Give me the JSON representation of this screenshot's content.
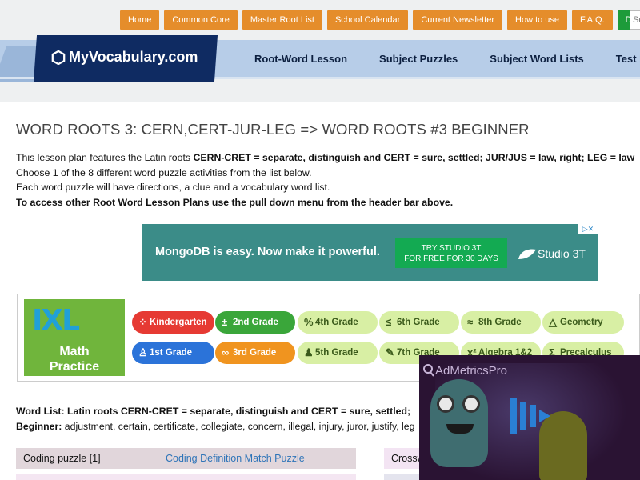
{
  "topnav": [
    "Home",
    "Common Core",
    "Master Root List",
    "School Calendar",
    "Current Newsletter",
    "How to use",
    "F.A.Q.",
    "Donate"
  ],
  "search_placeholder": "Se",
  "logo": "MyVocabulary.com",
  "mainnav": [
    "Root-Word Lesson",
    "Subject Puzzles",
    "Subject Word Lists",
    "Test Pre"
  ],
  "page_title": "WORD ROOTS 3: CERN,CERT-JUR-LEG => WORD ROOTS #3 BEGINNER",
  "intro": {
    "line1_prefix": "This lesson plan features the Latin roots ",
    "line1_bold": "CERN-CRET = separate, distinguish and CERT = sure, settled; JUR/JUS = law, right; LEG = law",
    "line2": "Choose 1 of the 8 different word puzzle activities from the list below.",
    "line3": "Each word puzzle will have directions, a clue and a vocabulary word list.",
    "line4": "To access other Root Word Lesson Plans use the pull down menu from the header bar above."
  },
  "ad1": {
    "text": "MongoDB is easy. Now make it powerful.",
    "cta_line1": "TRY STUDIO 3T",
    "cta_line2": "FOR FREE FOR 30 DAYS",
    "brand": "Studio 3T",
    "adchoices": "▷✕"
  },
  "ad2": {
    "logo": "IXL",
    "sub1": "Math",
    "sub2": "Practice",
    "grades": {
      "kindergarten": "Kindergarten",
      "grade2": "2nd Grade",
      "grade4": "4th Grade",
      "grade6": "6th Grade",
      "grade8": "8th Grade",
      "geometry": "Geometry",
      "grade1": "1st Grade",
      "grade3": "3rd Grade",
      "grade5": "5th Grade",
      "grade7": "7th Grade",
      "algebra": "Algebra 1&2",
      "precalc": "Precalculus"
    }
  },
  "wordlist": {
    "label": "Word List: Latin roots CERN-CRET = separate, distinguish and CERT = sure, settled;",
    "beginner_label": "Beginner:",
    "beginner_words": " adjustment, certain, certificate, collegiate, concern, illegal, injury, juror, justify, leg"
  },
  "puzzles": {
    "row1_col1": "Coding puzzle [1]",
    "row1_col2": "Coding Definition Match Puzzle",
    "row1_right": "Crossw"
  },
  "ad3": {
    "brand": "AdMetricsPro"
  }
}
